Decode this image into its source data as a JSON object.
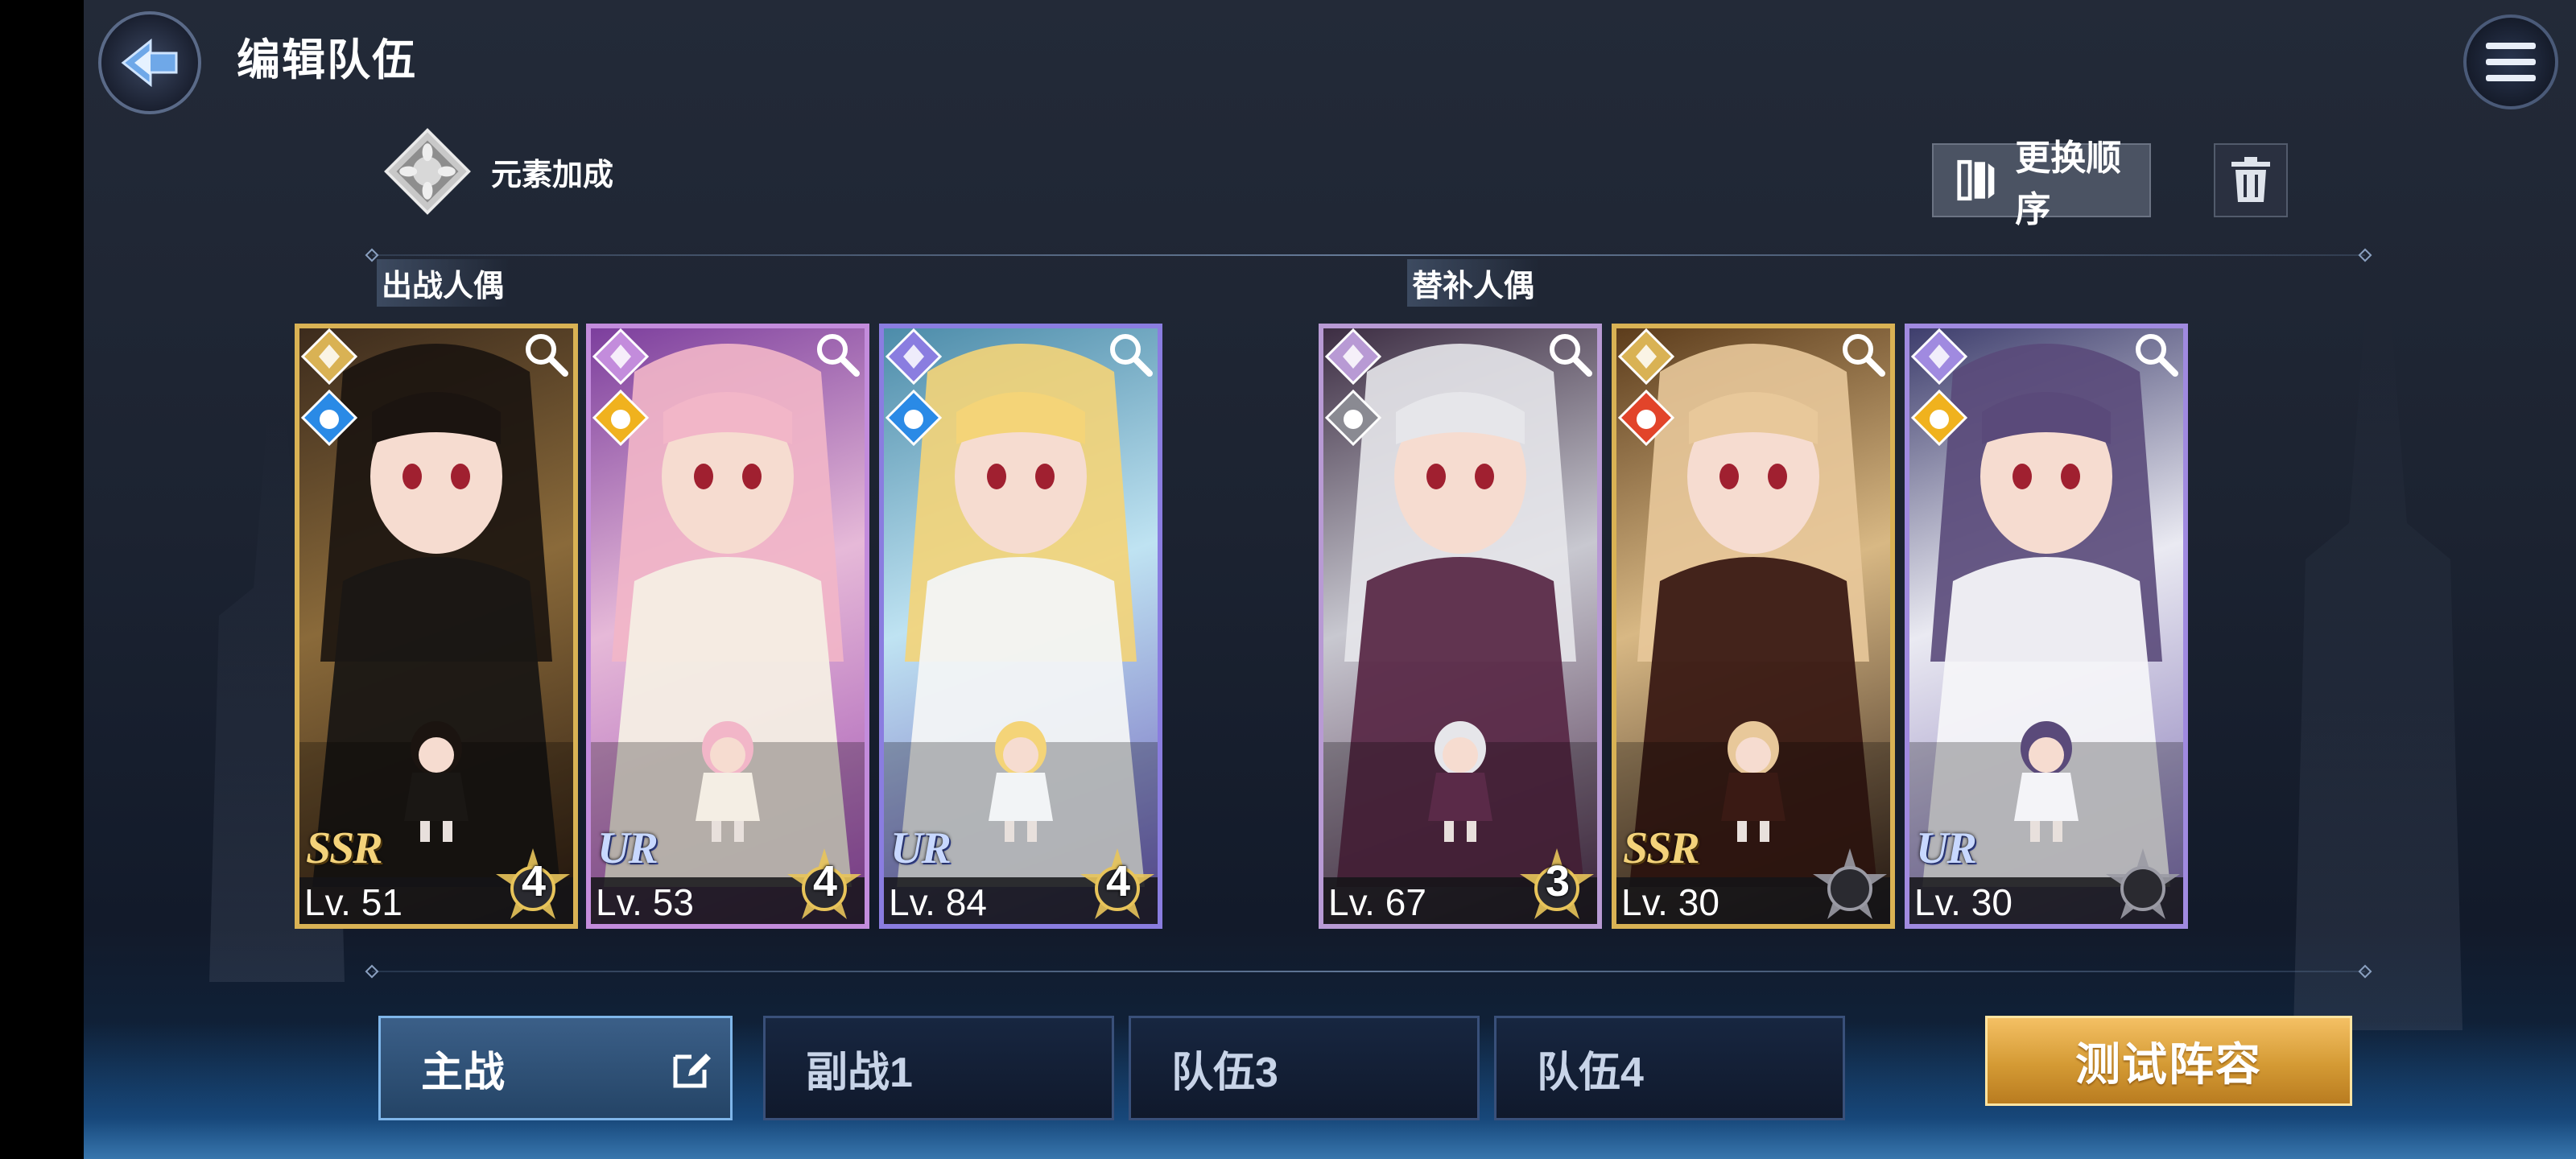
{
  "header": {
    "title": "编辑队伍",
    "back_icon": "back-arrow-icon",
    "menu_icon": "hamburger-menu-icon"
  },
  "toolbar": {
    "element_bonus_label": "元素加成",
    "reorder_label": "更换顺序",
    "trash_icon": "trash-icon"
  },
  "sections": {
    "main_label": "出战人偶",
    "sub_label": "替补人偶"
  },
  "cards": [
    {
      "rarity": "SSR",
      "level": "Lv. 51",
      "stars": "4",
      "element": "water",
      "frame_color": "#d9b254",
      "art": [
        "#3b2a1c",
        "#8a6a3a",
        "#2a1a10"
      ],
      "hair": "#1b1410",
      "dress": "#1a1714",
      "star_ring": "#e8c45a"
    },
    {
      "rarity": "UR",
      "level": "Lv. 53",
      "stars": "4",
      "element": "light",
      "frame_color": "#c38cdc",
      "art": [
        "#7a3c9c",
        "#e6b9d8",
        "#9a4ab0"
      ],
      "hair": "#f2b6c8",
      "dress": "#f4eee4",
      "star_ring": "#e8c45a"
    },
    {
      "rarity": "UR",
      "level": "Lv. 84",
      "stars": "4",
      "element": "water",
      "frame_color": "#8a7de0",
      "art": [
        "#4a8aa8",
        "#bfe3f2",
        "#6a58b8"
      ],
      "hair": "#f4d478",
      "dress": "#f2f4f6",
      "star_ring": "#e8c45a"
    },
    {
      "rarity": "",
      "level": "Lv. 67",
      "stars": "3",
      "element": "dark",
      "frame_color": "#b89ad4",
      "art": [
        "#3a2a40",
        "#c8c8d0",
        "#4a2a48"
      ],
      "hair": "#e6e6ea",
      "dress": "#5a2a48",
      "star_ring": "#e8c45a"
    },
    {
      "rarity": "SSR",
      "level": "Lv. 30",
      "stars": "",
      "element": "fire",
      "frame_color": "#d9b254",
      "art": [
        "#5a3a1a",
        "#d8b884",
        "#2a1a14"
      ],
      "hair": "#e8c89a",
      "dress": "#3a1a14",
      "star_ring": "#9a9aa4"
    },
    {
      "rarity": "UR",
      "level": "Lv. 30",
      "stars": "",
      "element": "light",
      "frame_color": "#a08ae0",
      "art": [
        "#3a3a6a",
        "#eaeaf2",
        "#7a6ab0"
      ],
      "hair": "#5a4a7a",
      "dress": "#f4f4f8",
      "star_ring": "#9a9aa4"
    }
  ],
  "tabs": [
    {
      "label": "主战",
      "active": true
    },
    {
      "label": "副战1",
      "active": false
    },
    {
      "label": "队伍3",
      "active": false
    },
    {
      "label": "队伍4",
      "active": false
    }
  ],
  "test_button_label": "测试阵容",
  "colors": {
    "accent_gold": "#d9a43c",
    "active_tab": "#7fb6ea",
    "water": "#2a8ae6",
    "light": "#f0b21e",
    "fire": "#e2442a",
    "dark": "#8a8a92"
  }
}
